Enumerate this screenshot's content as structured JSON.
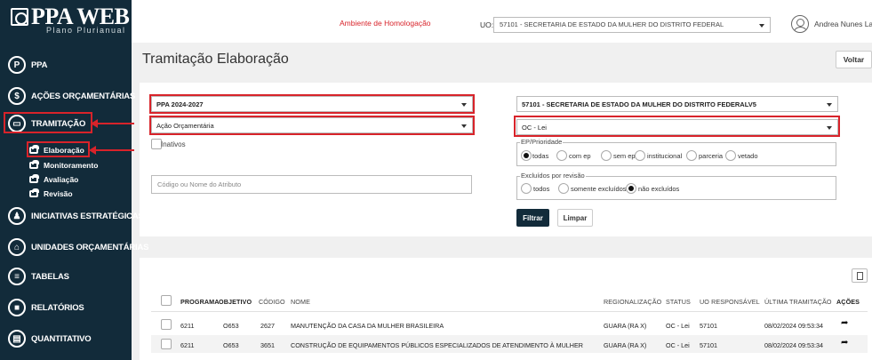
{
  "app": {
    "logo_title": "PPA WEB",
    "logo_subtitle": "Plano Plurianual"
  },
  "topbar": {
    "environment": "Ambiente de Homologação",
    "uo_label": "UO:",
    "uo_value": "57101 - SECRETARIA DE ESTADO DA MULHER DO DISTRITO FEDERAL",
    "user_name": "Andrea Nunes La... ˅"
  },
  "sidebar": {
    "items": [
      {
        "label": "PPA",
        "icon": "P"
      },
      {
        "label": "AÇÕES ORÇAMENTÁRIAS",
        "icon": "$"
      },
      {
        "label": "TRAMITAÇÃO",
        "icon": "▭"
      },
      {
        "label": "INICIATIVAS ESTRATÉGICAS",
        "icon": "♟"
      },
      {
        "label": "UNIDADES ORÇAMENTÁRIAS",
        "icon": "⌂"
      },
      {
        "label": "TABELAS",
        "icon": "≡"
      },
      {
        "label": "RELATÓRIOS",
        "icon": "■"
      },
      {
        "label": "QUANTITATIVO",
        "icon": "▤"
      }
    ],
    "subitems": [
      {
        "label": "Elaboração"
      },
      {
        "label": "Monitoramento"
      },
      {
        "label": "Avaliação"
      },
      {
        "label": "Revisão"
      }
    ]
  },
  "page": {
    "title": "Tramitação Elaboração",
    "back_label": "Voltar"
  },
  "filters": {
    "ppa_select": "PPA 2024-2027",
    "type_select": "Ação Orçamentária",
    "inactive_label": "Inativos",
    "search_placeholder": "Código ou Nome do Atributo",
    "uo_select": "57101 - SECRETARIA DE ESTADO DA MULHER DO DISTRITO FEDERALV5",
    "status_select": "OC - Lei",
    "ep_legend": "EP/Prioridade",
    "ep_options": [
      "todas",
      "com ep",
      "sem ep",
      "institucional",
      "parceria",
      "vetado"
    ],
    "ep_selected": "todas",
    "excl_legend": "Excluídos por revisão",
    "excl_options": [
      "todos",
      "somente excluídos",
      "não excluídos"
    ],
    "excl_selected": "não excluídos",
    "filter_label": "Filtrar",
    "clear_label": "Limpar"
  },
  "table": {
    "headers": [
      "PROGRAMA",
      "OBJETIVO",
      "CÓDIGO",
      "NOME",
      "REGIONALIZAÇÃO",
      "STATUS",
      "UO RESPONSÁVEL",
      "ÚLTIMA TRAMITAÇÃO",
      "AÇÕES"
    ],
    "rows": [
      {
        "programa": "6211",
        "objetivo": "O653",
        "codigo": "2627",
        "nome": "MANUTENÇÃO DA CASA DA MULHER BRASILEIRA",
        "regionalizacao": "GUARA (RA X)",
        "status": "OC - Lei",
        "uo": "57101",
        "ultima": "08/02/2024 09:53:34"
      },
      {
        "programa": "6211",
        "objetivo": "O653",
        "codigo": "3651",
        "nome": "CONSTRUÇÃO DE EQUIPAMENTOS PÚBLICOS ESPECIALIZADOS DE ATENDIMENTO À MULHER",
        "regionalizacao": "GUARA (RA X)",
        "status": "OC - Lei",
        "uo": "57101",
        "ultima": "08/02/2024 09:53:34"
      }
    ]
  },
  "colors": {
    "sidebar_bg": "#122b3a",
    "highlight": "#d8232a",
    "env_text": "#d8232a"
  }
}
